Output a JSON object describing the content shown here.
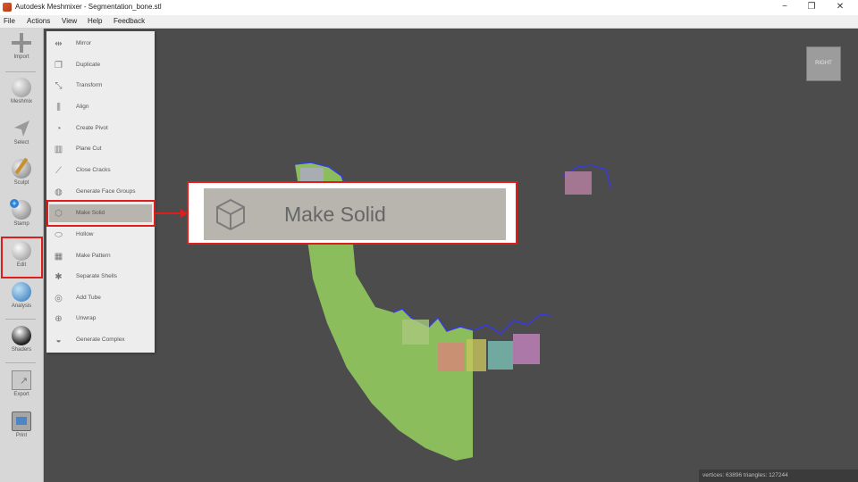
{
  "window": {
    "title": "Autodesk Meshmixer - Segmentation_bone.stl",
    "controls": {
      "minimize": "−",
      "restore": "❐",
      "close": "✕"
    }
  },
  "menubar": {
    "items": [
      "File",
      "Actions",
      "View",
      "Help",
      "Feedback"
    ]
  },
  "toolbar": {
    "items": [
      {
        "label": "Import",
        "icon": "plus-icon"
      },
      {
        "label": "Meshmix",
        "icon": "sphere-icon"
      },
      {
        "label": "Select",
        "icon": "arrow-cursor-icon"
      },
      {
        "label": "Sculpt",
        "icon": "brush-icon"
      },
      {
        "label": "Stamp",
        "icon": "stamp-icon"
      },
      {
        "label": "Edit",
        "icon": "edit-sphere-icon"
      },
      {
        "label": "Analysis",
        "icon": "globe-icon"
      },
      {
        "label": "Shaders",
        "icon": "shader-sphere-icon"
      },
      {
        "label": "Export",
        "icon": "export-icon"
      },
      {
        "label": "Print",
        "icon": "print-icon"
      }
    ]
  },
  "edit_menu": {
    "items": [
      {
        "label": "Mirror",
        "icon": "mirror-icon"
      },
      {
        "label": "Duplicate",
        "icon": "duplicate-icon"
      },
      {
        "label": "Transform",
        "icon": "transform-icon"
      },
      {
        "label": "Align",
        "icon": "align-icon"
      },
      {
        "label": "Create Pivot",
        "icon": "pivot-icon"
      },
      {
        "label": "Plane Cut",
        "icon": "plane-cut-icon"
      },
      {
        "label": "Close Cracks",
        "icon": "close-cracks-icon"
      },
      {
        "label": "Generate Face Groups",
        "icon": "face-groups-icon"
      },
      {
        "label": "Make Solid",
        "icon": "cube-icon",
        "selected": true
      },
      {
        "label": "Hollow",
        "icon": "hollow-icon"
      },
      {
        "label": "Make Pattern",
        "icon": "pattern-icon"
      },
      {
        "label": "Separate Shells",
        "icon": "shells-icon"
      },
      {
        "label": "Add Tube",
        "icon": "tube-icon"
      },
      {
        "label": "Unwrap",
        "icon": "unwrap-icon"
      },
      {
        "label": "Generate Complex",
        "icon": "complex-icon"
      }
    ]
  },
  "callout": {
    "label": "Make Solid",
    "icon": "cube-icon"
  },
  "view_cube": {
    "label": "RIGHT"
  },
  "status": {
    "text": "vertices: 63896 triangles: 127244"
  },
  "colors": {
    "viewport_bg": "#4c4c4c",
    "highlight": "#e01d1d",
    "mesh_green": "#8cbd5c",
    "mesh_purple": "#9d8bd6"
  }
}
